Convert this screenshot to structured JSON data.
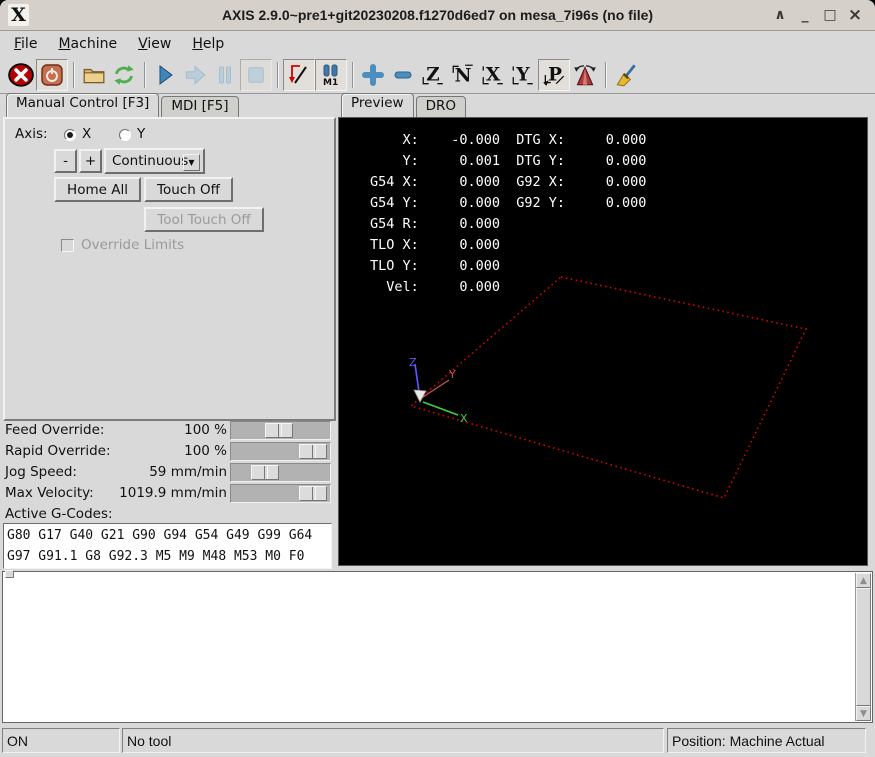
{
  "window": {
    "title": "AXIS 2.9.0~pre1+git20230208.f1270d6ed7 on mesa_7i96s (no file)",
    "icon_letter": "X",
    "controls": [
      {
        "name": "shade",
        "glyph": "∧"
      },
      {
        "name": "minimize",
        "glyph": "_"
      },
      {
        "name": "maximize",
        "glyph": "□"
      },
      {
        "name": "close",
        "glyph": "×"
      }
    ]
  },
  "menu": {
    "items": [
      "File",
      "Machine",
      "View",
      "Help"
    ]
  },
  "toolbar": {
    "buttons": [
      "estop",
      "machine-power",
      "open-file",
      "reload",
      "run",
      "step",
      "pause",
      "stop",
      "toggle-skip-lines",
      "toggle-optional-pause",
      "zoom-in",
      "zoom-out",
      "view-z",
      "view-z-rotated",
      "view-x",
      "view-y",
      "view-p",
      "rotate-view",
      "clear-plot"
    ],
    "optional_pause_label": "M1"
  },
  "left_tabs": {
    "manual": "Manual Control [F3]",
    "mdi": "MDI [F5]"
  },
  "manual": {
    "axis_label": "Axis:",
    "axis_x": "X",
    "axis_y": "Y",
    "selected_axis": "X",
    "jog_minus": "-",
    "jog_plus": "+",
    "jog_mode": "Continuous",
    "home_all": "Home All",
    "touch_off": "Touch Off",
    "tool_touch_off": "Tool Touch Off",
    "override_limits": "Override Limits",
    "override_limits_checked": false
  },
  "sliders": {
    "rows": [
      {
        "label": "Feed Override:",
        "value": "100 %"
      },
      {
        "label": "Rapid Override:",
        "value": "100 %"
      },
      {
        "label": "Jog Speed:",
        "value": "59 mm/min"
      },
      {
        "label": "Max Velocity:",
        "value": "1019.9 mm/min"
      }
    ]
  },
  "gcodes": {
    "label": "Active G-Codes:",
    "lines": [
      "G80 G17 G40 G21 G90 G94 G54 G49 G99 G64",
      "G97 G91.1 G8 G92.3 M5 M9 M48 M53 M0 F0"
    ]
  },
  "right_tabs": {
    "preview": "Preview",
    "dro": "DRO"
  },
  "preview": {
    "dro_lines": [
      "    X:    -0.000  DTG X:     0.000",
      "    Y:     0.001  DTG Y:     0.000",
      "G54 X:     0.000  G92 X:     0.000",
      "G54 Y:     0.000  G92 Y:     0.000",
      "G54 R:     0.000",
      "TLO X:     0.000",
      "TLO Y:     0.000",
      "  Vel:     0.000"
    ],
    "axis_labels": {
      "x": "X",
      "y": "Y",
      "z": "Z"
    },
    "colors": {
      "background": "#000000",
      "limit_boundary": "#e60000",
      "x_axis": "#3fcf3f",
      "y_axis": "#cc5555",
      "z_axis": "#5b5bff",
      "tool_cone": "#e8e8e8",
      "dro_text": "#ffffff"
    }
  },
  "statusbar": {
    "machine_state": "ON",
    "tool": "No tool",
    "position": "Position: Machine Actual"
  }
}
